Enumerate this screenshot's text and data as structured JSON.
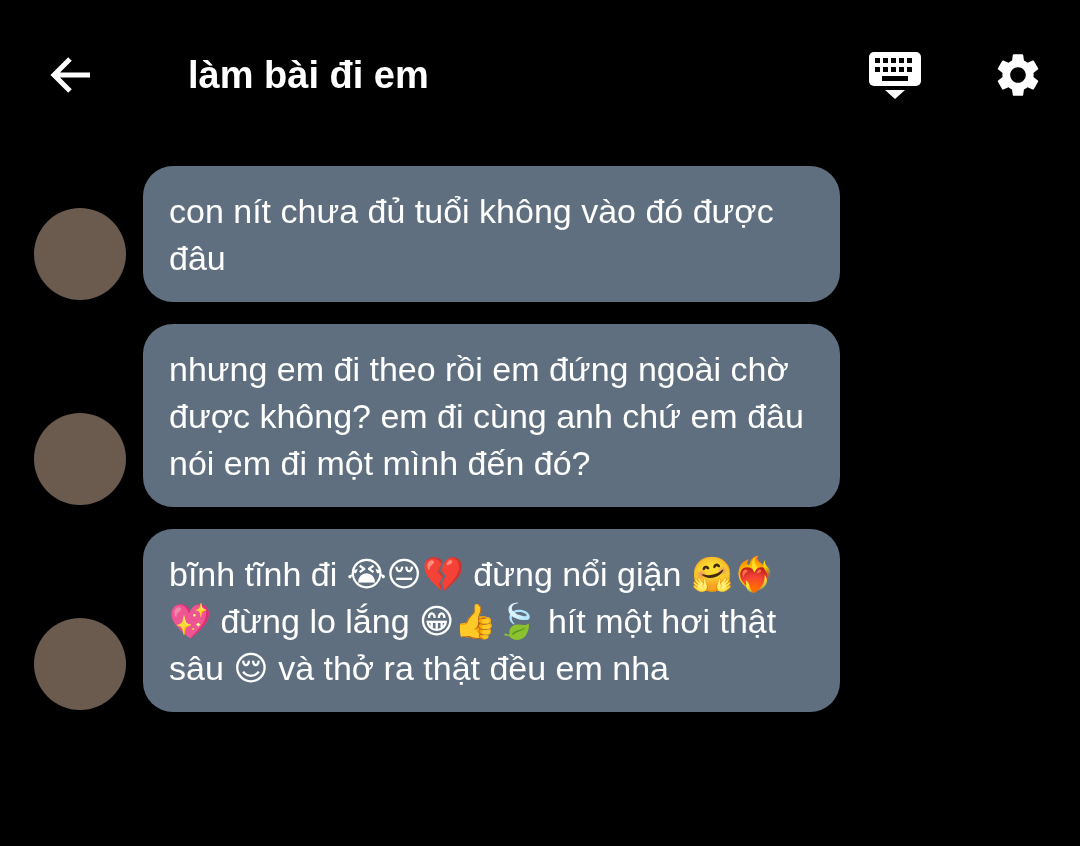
{
  "header": {
    "title": "làm bài đi em"
  },
  "messages": [
    {
      "text": "con nít chưa đủ tuổi không vào đó được đâu"
    },
    {
      "text": "nhưng em đi theo rồi em đứng ngoài chờ được không? em đi cùng anh chứ em đâu nói em đi một mình đến đó?"
    },
    {
      "text": "bĩnh tĩnh đi 😭😔💔 đừng nổi giận 🤗❤️‍🔥💖 đừng lo lắng 😁👍🍃 hít một hơi thật sâu 😌 và thở ra thật đều em nha"
    }
  ]
}
